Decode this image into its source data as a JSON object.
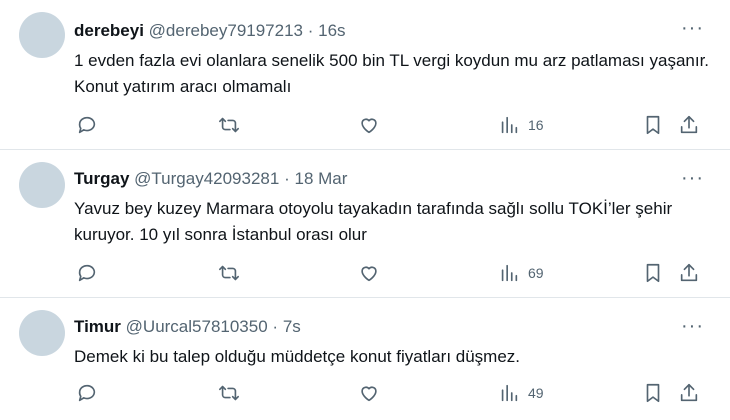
{
  "tweets": [
    {
      "name": "derebeyi",
      "handle": "@derebey79197213",
      "separator": "·",
      "time": "16s",
      "more": "···",
      "text": "1 evden fazla evi olanlara senelik 500 bin TL vergi koydun mu arz patlaması yaşanır. Konut yatırım aracı olmamalı",
      "views": "16"
    },
    {
      "name": "Turgay",
      "handle": "@Turgay42093281",
      "separator": "·",
      "time": "18 Mar",
      "more": "···",
      "text": "Yavuz bey kuzey Marmara otoyolu tayakadın tarafında sağlı sollu TOKİ’ler şehir kuruyor. 10 yıl sonra İstanbul orası olur",
      "views": "69"
    },
    {
      "name": "Timur",
      "handle": "@Uurcal57810350",
      "separator": "·",
      "time": "7s",
      "more": "···",
      "text": "Demek ki bu talep olduğu müddetçe konut fiyatları düşmez.",
      "views": "49"
    }
  ],
  "icons": [
    "reply-icon",
    "retweet-icon",
    "like-icon",
    "views-icon",
    "bookmark-icon",
    "share-icon"
  ],
  "colors": {
    "text": "#0f1419",
    "secondary": "#536471",
    "divider": "#e1e6ea",
    "avatar": "#c9d6df"
  }
}
